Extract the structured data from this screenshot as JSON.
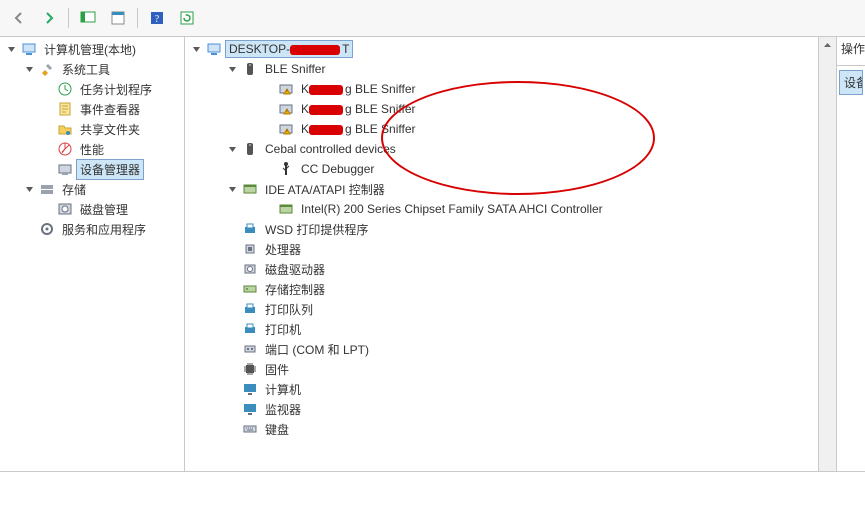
{
  "toolbar": {
    "icons": [
      "nav-back-icon",
      "nav-forward-icon",
      "show-hide-console-icon",
      "properties-icon",
      "help-icon",
      "refresh-icon"
    ]
  },
  "left_tree": {
    "root": {
      "label": "计算机管理(本地)",
      "children": [
        {
          "label": "系统工具",
          "icon": "tools",
          "expanded": true,
          "children": [
            {
              "label": "任务计划程序",
              "icon": "clock"
            },
            {
              "label": "事件查看器",
              "icon": "event"
            },
            {
              "label": "共享文件夹",
              "icon": "folder-share"
            },
            {
              "label": "性能",
              "icon": "perf"
            },
            {
              "label": "设备管理器",
              "icon": "device",
              "selected": true
            }
          ]
        },
        {
          "label": "存储",
          "icon": "storage",
          "expanded": true,
          "children": [
            {
              "label": "磁盘管理",
              "icon": "disk"
            }
          ]
        },
        {
          "label": "服务和应用程序",
          "icon": "services"
        }
      ]
    }
  },
  "device_tree": {
    "root_label": "DESKTOP-",
    "root_suffix_hidden": "T",
    "children": [
      {
        "label": "BLE Sniffer",
        "icon": "ble",
        "expanded": true,
        "children": [
          {
            "label_prefix": "K",
            "label_suffix": "g BLE Sniffer",
            "redacted": true,
            "icon": "warn-dev"
          },
          {
            "label_prefix": "K",
            "label_suffix": "g BLE Sniffer",
            "redacted": true,
            "icon": "warn-dev"
          },
          {
            "label_prefix": "K",
            "label_suffix": "g BLE Sniffer",
            "redacted": true,
            "icon": "warn-dev"
          }
        ]
      },
      {
        "label": "Cebal controlled devices",
        "icon": "ble",
        "expanded": true,
        "children": [
          {
            "label": "CC Debugger",
            "icon": "usb"
          }
        ]
      },
      {
        "label": "IDE ATA/ATAPI 控制器",
        "icon": "ide",
        "expanded": true,
        "children": [
          {
            "label": "Intel(R) 200 Series Chipset Family SATA AHCI Controller",
            "icon": "ide"
          }
        ]
      },
      {
        "label": "WSD 打印提供程序",
        "icon": "printer"
      },
      {
        "label": "处理器",
        "icon": "cpu"
      },
      {
        "label": "磁盘驱动器",
        "icon": "hdd"
      },
      {
        "label": "存储控制器",
        "icon": "storage-ctrl"
      },
      {
        "label": "打印队列",
        "icon": "printer"
      },
      {
        "label": "打印机",
        "icon": "printer"
      },
      {
        "label": "端口 (COM 和 LPT)",
        "icon": "port"
      },
      {
        "label": "固件",
        "icon": "chip"
      },
      {
        "label": "计算机",
        "icon": "monitor"
      },
      {
        "label": "监视器",
        "icon": "monitor"
      },
      {
        "label": "键盘",
        "icon": "keyboard"
      }
    ]
  },
  "right": {
    "header": "操作",
    "item": "设备"
  },
  "annotation": {
    "ellipse_region": "ble-sniffer-group"
  }
}
